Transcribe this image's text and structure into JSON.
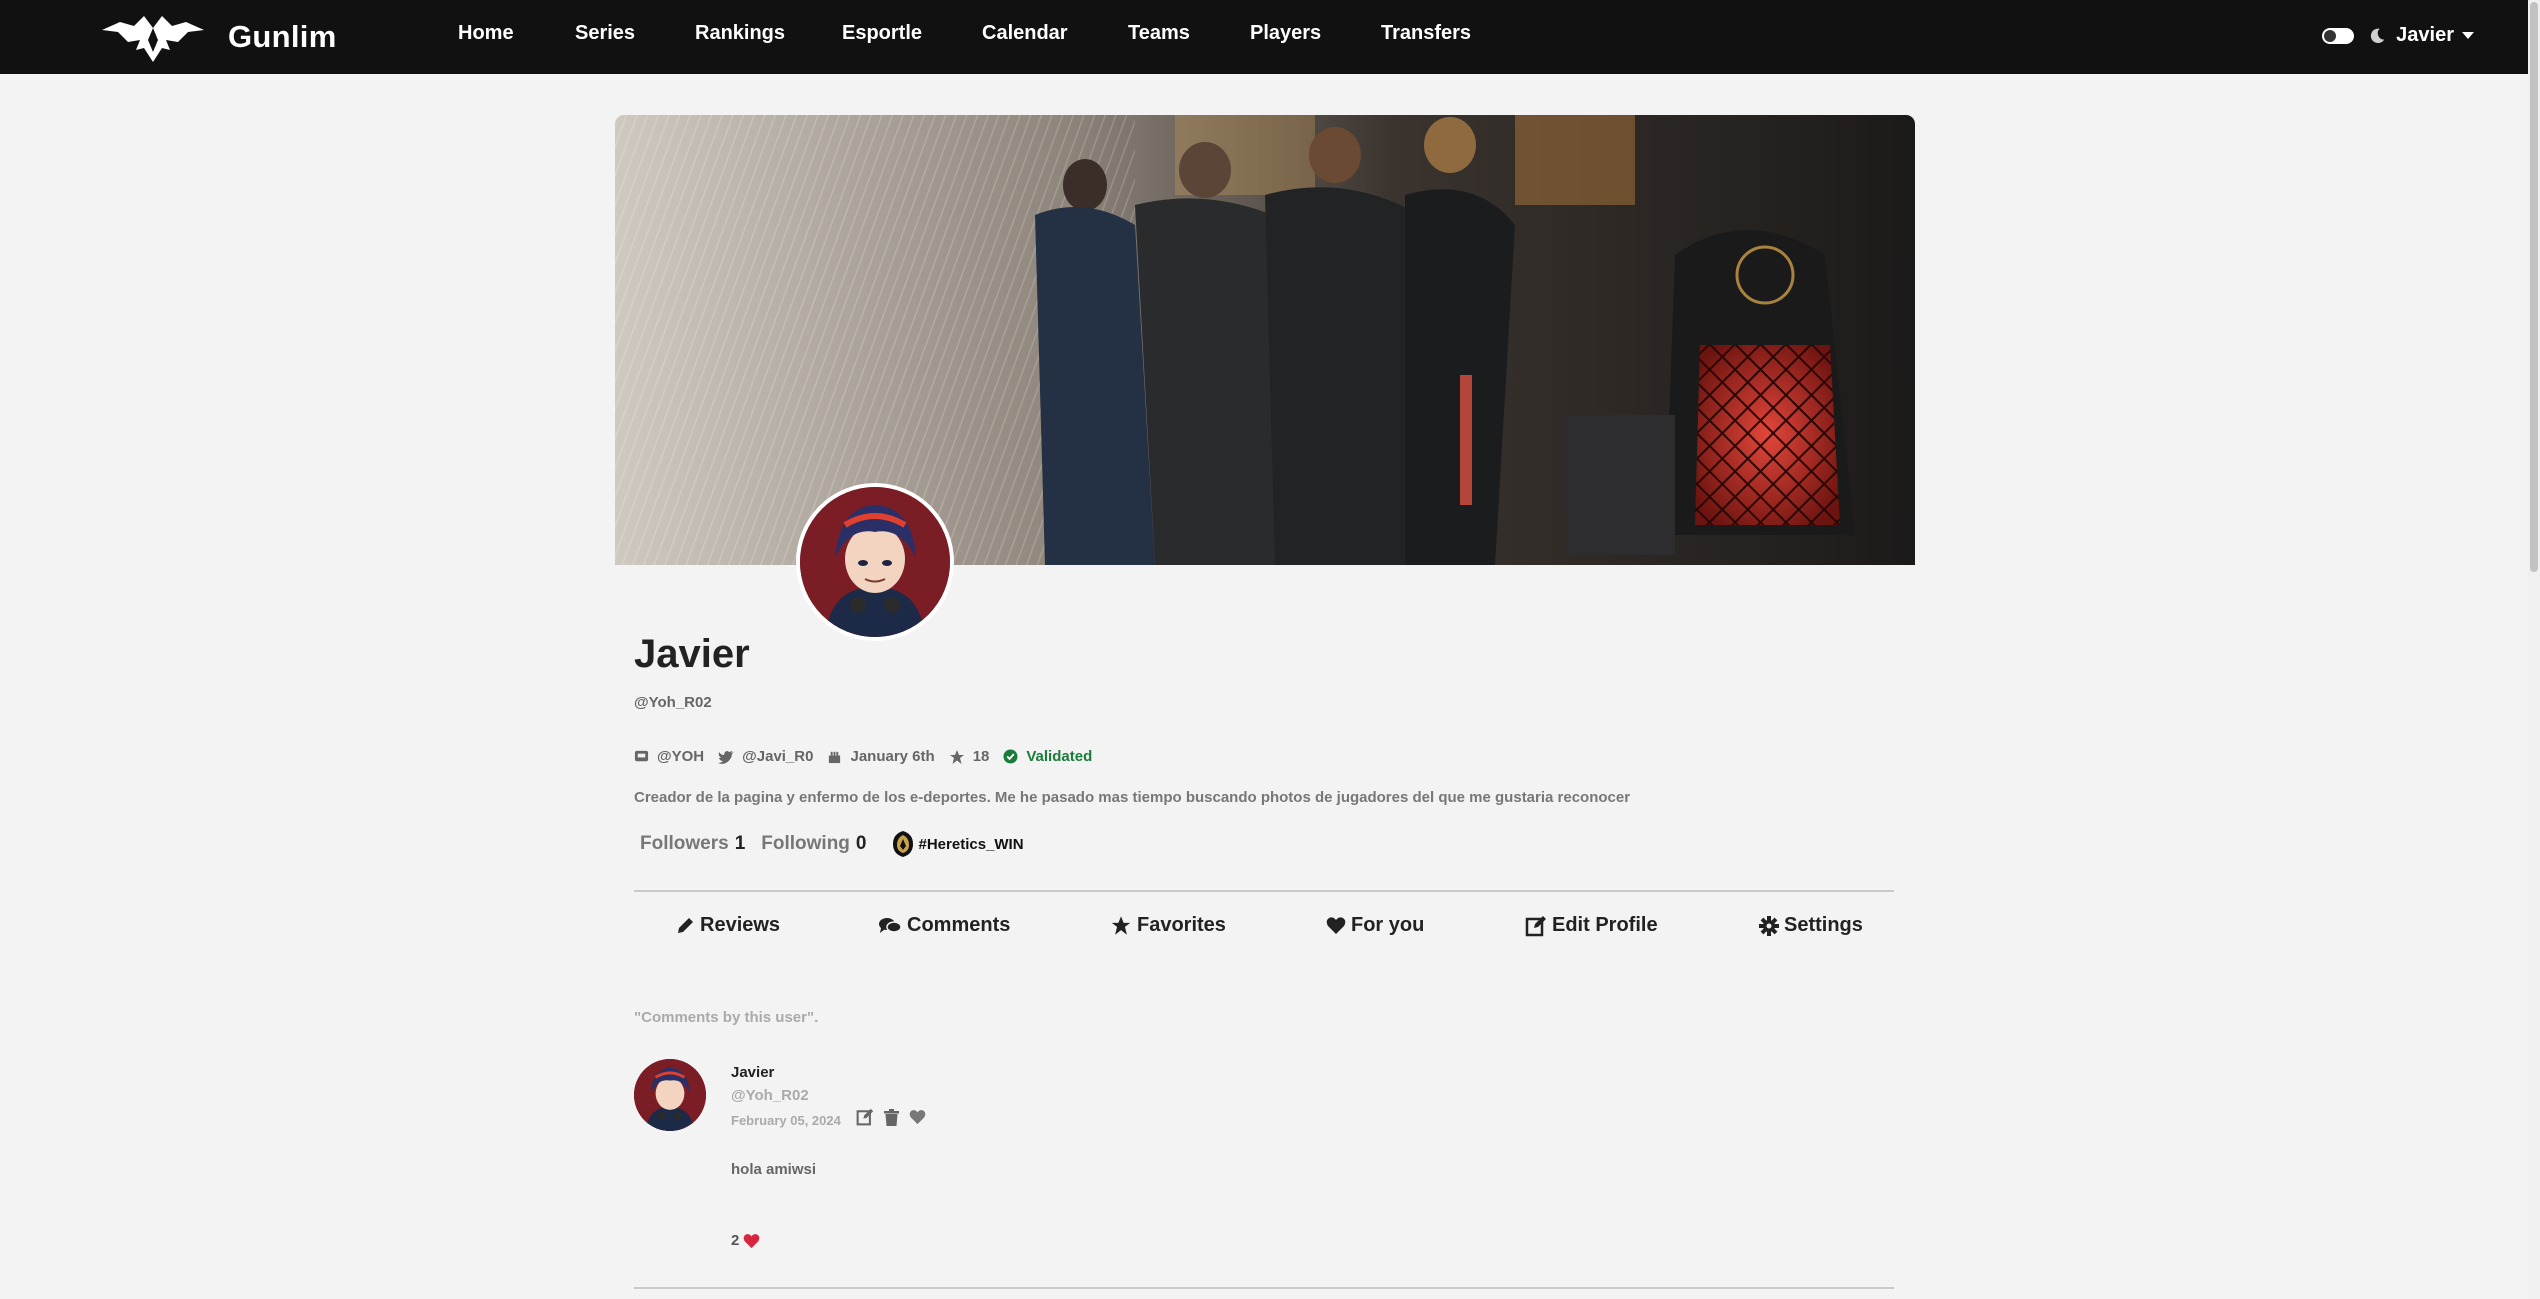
{
  "brand": {
    "name": "Gunlim",
    "logo_icon": "winged-emblem-icon"
  },
  "nav": {
    "items": [
      {
        "label": "Home"
      },
      {
        "label": "Series"
      },
      {
        "label": "Rankings"
      },
      {
        "label": "Esportle"
      },
      {
        "label": "Calendar"
      },
      {
        "label": "Teams"
      },
      {
        "label": "Players"
      },
      {
        "label": "Transfers"
      }
    ],
    "theme_toggle_icon": "toggle-switch-icon",
    "dark_mode_icon": "moon-icon",
    "user_menu_label": "Javier"
  },
  "profile": {
    "banner_image": "esports-team-celebrating-on-stage",
    "avatar_image": "anime-character-avatar",
    "name": "Javier",
    "handle": "@Yoh_R02",
    "meta": {
      "discord": "@YOH",
      "twitter": "@Javi_R0",
      "birthday": "January 6th",
      "points": "18",
      "status": "Validated"
    },
    "bio": "Creador de la pagina y enfermo de los e-deportes. Me he pasado mas tiempo buscando photos de jugadores del que me gustaria reconocer",
    "followers_label": "Followers",
    "followers_count": "1",
    "following_label": "Following",
    "following_count": "0",
    "team_tag": "#Heretics_WIN"
  },
  "tabs": [
    {
      "label": "Reviews",
      "icon": "pencil-icon"
    },
    {
      "label": "Comments",
      "icon": "comments-icon"
    },
    {
      "label": "Favorites",
      "icon": "star-icon"
    },
    {
      "label": "For you",
      "icon": "heart-icon"
    },
    {
      "label": "Edit Profile",
      "icon": "edit-icon"
    },
    {
      "label": "Settings",
      "icon": "gear-icon"
    }
  ],
  "comments_section": {
    "note": "\"Comments by this user\".",
    "items": [
      {
        "author": "Javier",
        "handle": "@Yoh_R02",
        "date": "February 05, 2024",
        "text": "hola amiwsi",
        "likes": "2"
      }
    ]
  },
  "colors": {
    "navbar_bg": "#111111",
    "page_bg": "#f3f3f3",
    "validated_green": "#1a7c3a",
    "like_red": "#d7263d"
  }
}
